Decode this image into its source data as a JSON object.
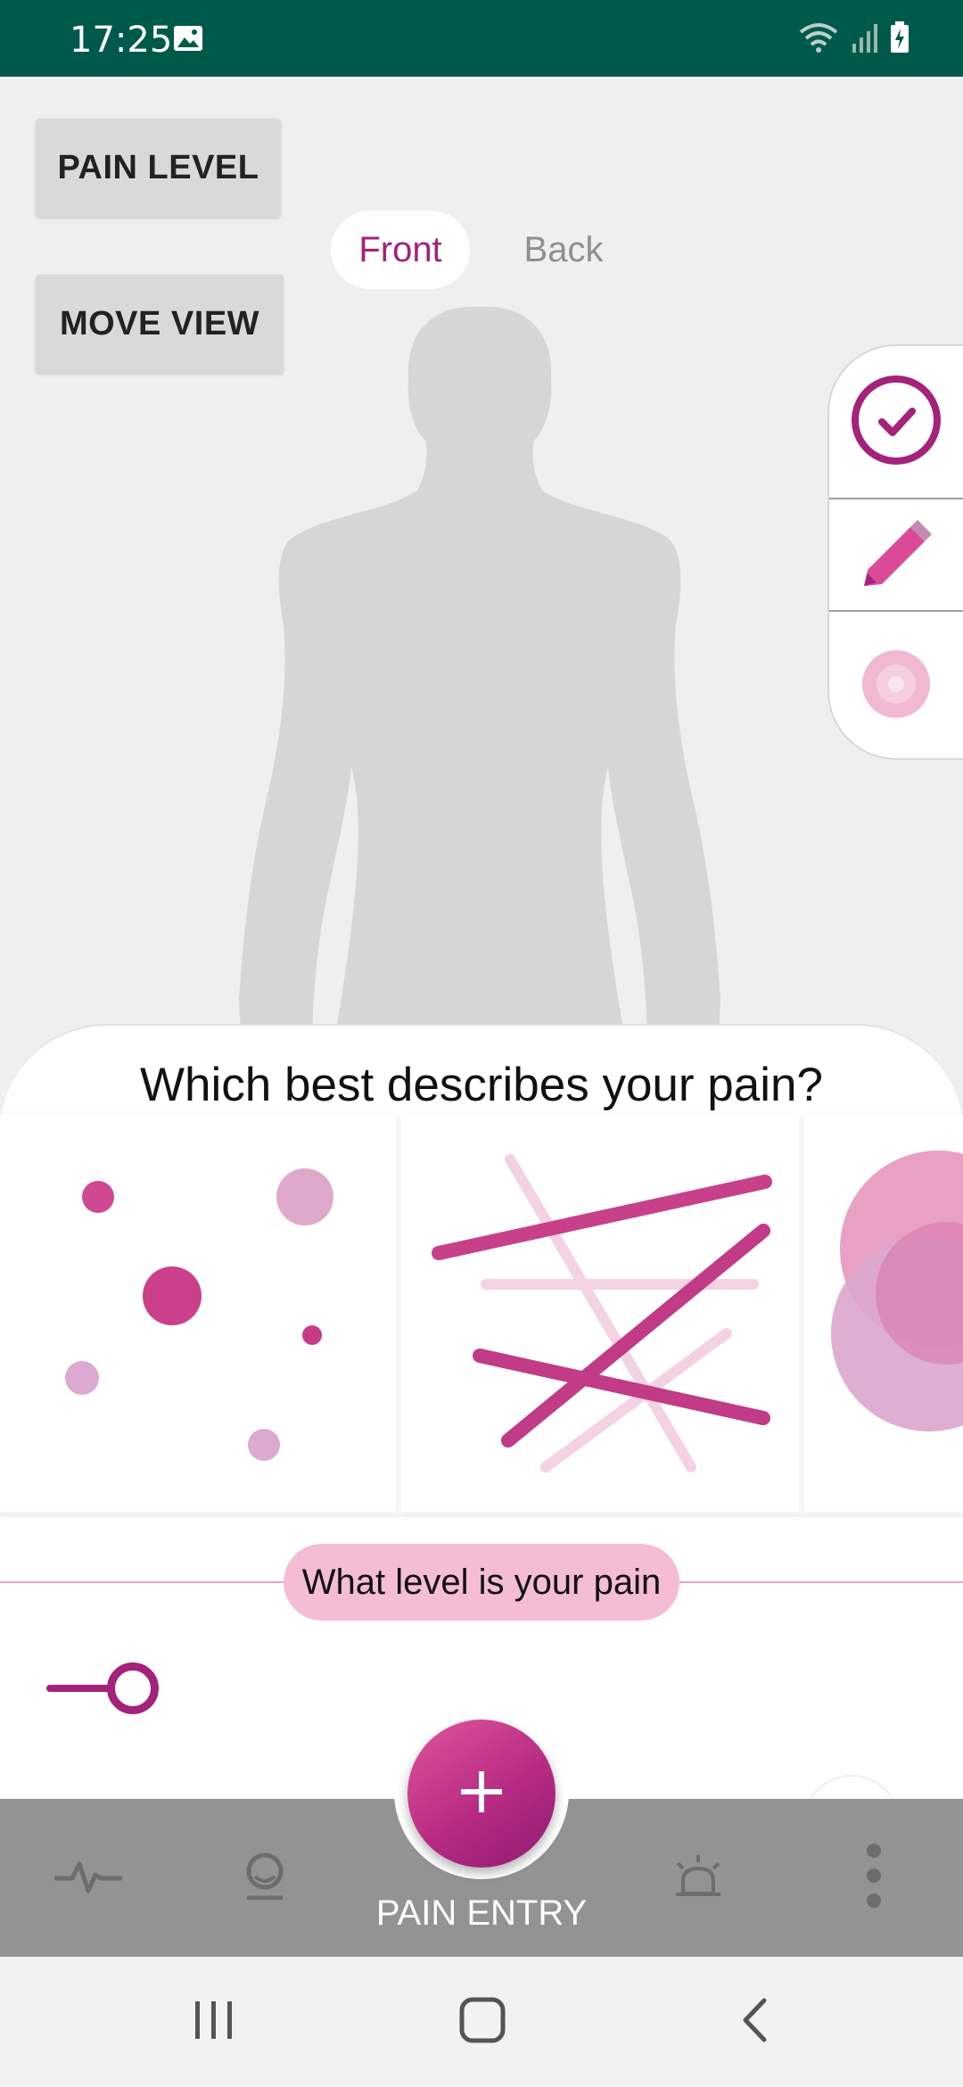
{
  "status_bar": {
    "time": "17:25"
  },
  "buttons": {
    "pain_level": "PAIN LEVEL",
    "move_view": "MOVE VIEW"
  },
  "view_toggle": {
    "front": "Front",
    "back": "Back",
    "selected": "Front"
  },
  "tools": [
    "check-circle-icon",
    "pencil-icon",
    "pain-point-icon"
  ],
  "sheet": {
    "title": "Which best describes your pain?",
    "options": [
      "dots-pattern",
      "lines-pattern",
      "circles-pattern"
    ],
    "level_label": "What level is your pain",
    "level_value": 0
  },
  "bottom_nav": {
    "items": [
      "pulse-icon",
      "profile-icon",
      "pain-entry",
      "alert-icon",
      "more-icon"
    ],
    "active_label": "PAIN ENTRY"
  },
  "colors": {
    "accent": "#a4227a",
    "status_bar": "#005a4b",
    "pill": "#f4bcd7",
    "nav": "#939393"
  }
}
